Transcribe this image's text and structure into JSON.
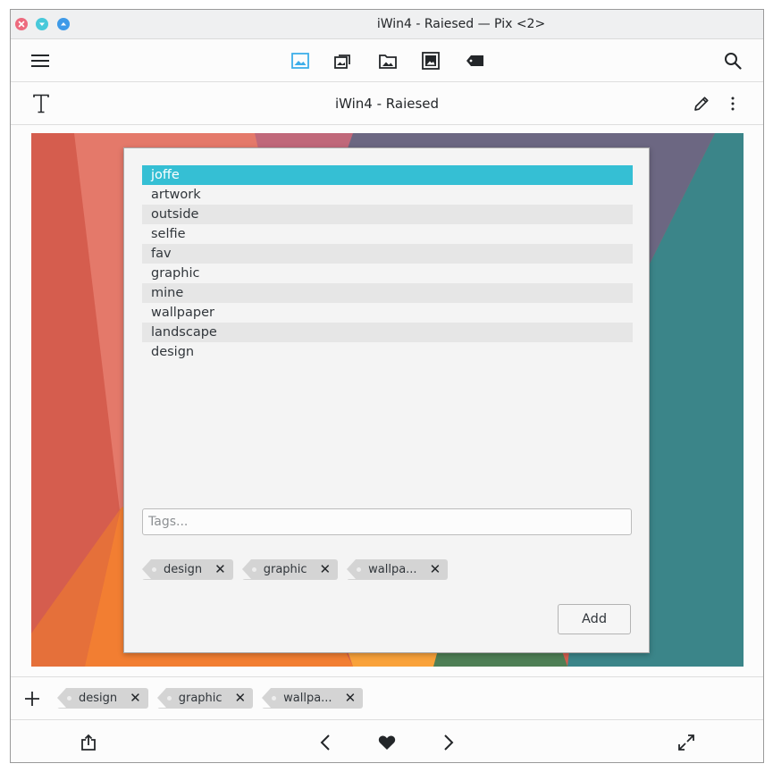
{
  "window": {
    "title": "iWin4 - Raiesed — Pix <2>"
  },
  "subtitle": "iWin4 - Raiesed",
  "icons": {
    "close": "close-icon",
    "minimize": "minimize-icon",
    "maximize": "maximize-icon",
    "menu": "hamburger-menu-icon",
    "view_images": "image-icon",
    "view_albums": "albums-icon",
    "view_folders": "folder-image-icon",
    "view_gallery": "gallery-icon",
    "view_tags": "tag-icon",
    "search": "search-icon",
    "text": "text-icon",
    "edit": "pencil-icon",
    "more": "more-vertical-icon",
    "add_tag": "plus-icon",
    "share": "share-icon",
    "previous": "chevron-left-icon",
    "favorite": "heart-icon",
    "next": "chevron-right-icon",
    "fullscreen": "fullscreen-icon"
  },
  "colors": {
    "accent": "#35bfd4",
    "toolbar_active": "#3daee9",
    "close_button": "#ed6a7e",
    "minimize_button": "#48c9da",
    "maximize_button": "#3e9ae8"
  },
  "dialog": {
    "tags": [
      {
        "label": "joffe",
        "selected": true
      },
      {
        "label": "artwork",
        "selected": false
      },
      {
        "label": "outside",
        "selected": false
      },
      {
        "label": "selfie",
        "selected": false
      },
      {
        "label": "fav",
        "selected": false
      },
      {
        "label": "graphic",
        "selected": false
      },
      {
        "label": "mine",
        "selected": false
      },
      {
        "label": "wallpaper",
        "selected": false
      },
      {
        "label": "landscape",
        "selected": false
      },
      {
        "label": "design",
        "selected": false
      }
    ],
    "input_placeholder": "Tags...",
    "input_value": "",
    "chips": [
      "design",
      "graphic",
      "wallpa..."
    ],
    "add_label": "Add"
  },
  "bottom_tags": [
    "design",
    "graphic",
    "wallpa..."
  ],
  "chip_remove": "✕"
}
